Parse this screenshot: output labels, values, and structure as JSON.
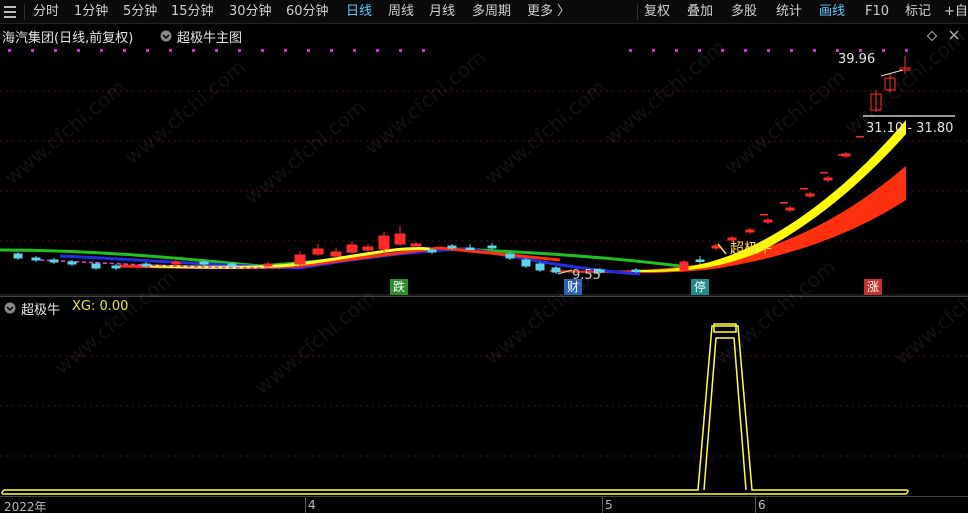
{
  "toolbar": {
    "menu_icon": "hamburger-icon",
    "periods": [
      "分时",
      "1分钟",
      "5分钟",
      "15分钟",
      "30分钟",
      "60分钟",
      "日线",
      "周线",
      "月线",
      "多周期",
      "更多 〉"
    ],
    "active_period": "日线",
    "right_items": [
      "复权",
      "叠加",
      "多股",
      "统计",
      "画线",
      "F10",
      "标记",
      "+自"
    ],
    "active_right": "画线"
  },
  "info": {
    "stock_title": "海汽集团(日线,前复权)",
    "main_indicator": "超极牛主图"
  },
  "main_chart": {
    "high_label": "39.96",
    "range_label": "31.10 - 31.80",
    "low_label": "9.55",
    "signal_text": "超极牛",
    "markers": [
      {
        "text": "跌",
        "color": "#2e8b2e"
      },
      {
        "text": "财",
        "color": "#2a5fb8"
      },
      {
        "text": "停",
        "color": "#1e8c8c"
      },
      {
        "text": "涨",
        "color": "#c83030"
      }
    ]
  },
  "sub_panel": {
    "name": "超极牛",
    "xg_label": "XG: 0.00"
  },
  "date_axis": {
    "labels": [
      "2022年",
      "4",
      "5",
      "6"
    ]
  },
  "watermark": "www.cfchi.com",
  "colors": {
    "up": "#ff2a2a",
    "down": "#5fd4e8",
    "yellow_band": "#ffff00",
    "red_band": "#ff3010",
    "grid": "#7a1a1a"
  }
}
